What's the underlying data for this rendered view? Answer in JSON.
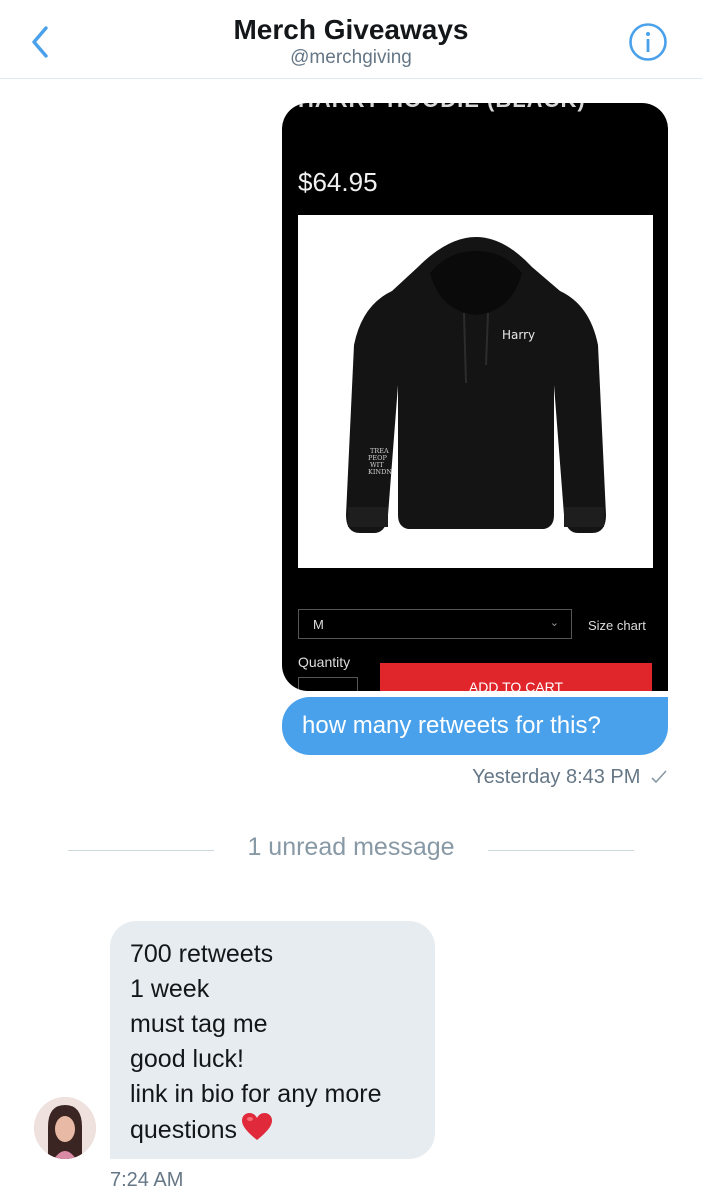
{
  "header": {
    "title": "Merch Giveaways",
    "handle": "@merchgiving"
  },
  "product": {
    "name": "HARRY HOODIE (BLACK)",
    "price": "$64.95",
    "hoodie_print": "Harry",
    "sleeve_print": "TREAT PEOPLE WITH KINDNESS",
    "size_value": "M",
    "size_chart": "Size chart",
    "quantity_label": "Quantity",
    "add_to_cart": "ADD TO CART"
  },
  "messages": {
    "outgoing_text": "how many retweets for this?",
    "outgoing_time": "Yesterday 8:43 PM",
    "unread_divider": "1 unread message",
    "incoming_lines": [
      "700 retweets",
      "1 week",
      "must tag me",
      "good luck!",
      "link in bio for any more",
      "questions"
    ],
    "incoming_time": "7:24 AM"
  },
  "colors": {
    "accent": "#4aa1eb",
    "incoming_bubble": "#e6ecf0",
    "add_to_cart": "#e0262b"
  }
}
